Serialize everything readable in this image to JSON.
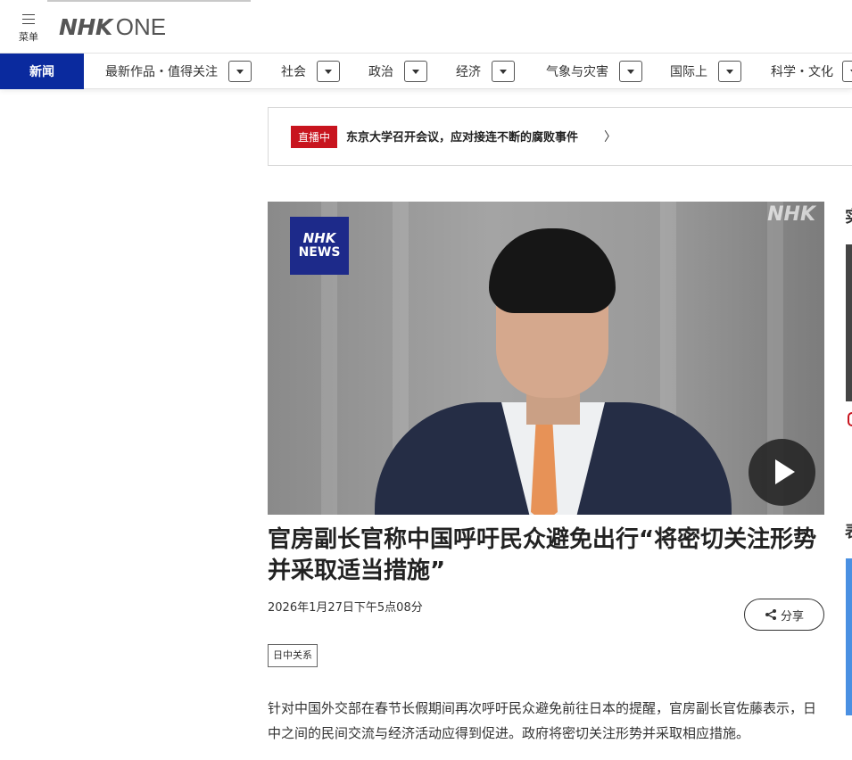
{
  "header": {
    "menu_label": "菜单",
    "logo_nhk": "NHK",
    "logo_one": "ONE"
  },
  "nav": {
    "active": "新闻",
    "items": [
      {
        "label": "最新作品・值得关注"
      },
      {
        "label": "社会"
      },
      {
        "label": "政治"
      },
      {
        "label": "经济"
      },
      {
        "label": "气象与灾害"
      },
      {
        "label": "国际上"
      },
      {
        "label": "科学・文化"
      }
    ]
  },
  "live": {
    "badge": "直播中",
    "text": "东京大学召开会议，应对接连不断的腐败事件",
    "chevron": "〉"
  },
  "video": {
    "logo_line1": "NHK",
    "logo_line2": "NEWS",
    "watermark": "NHK"
  },
  "article": {
    "headline": "官房副长官称中国呼吁民众避免出行“将密切关注形势并采取适当措施”",
    "date": "2026年1月27日下午5点08分",
    "share_label": "分享",
    "tag": "日中关系",
    "body": "针对中国外交部在春节长假期间再次呼吁民众避免前往日本的提醒，官房副长官佐藤表示，日中之间的民间交流与经济活动应得到促进。政府将密切关注形势并采取相应措施。"
  },
  "sidebar": {
    "heading1_fragment": "实",
    "heading2_fragment": "表"
  },
  "colors": {
    "nav_active_bg": "#0a2a9e",
    "live_badge": "#c8141e",
    "news_logo_bg": "#1d2a8a",
    "sidebar_accent": "#4a90e2"
  }
}
